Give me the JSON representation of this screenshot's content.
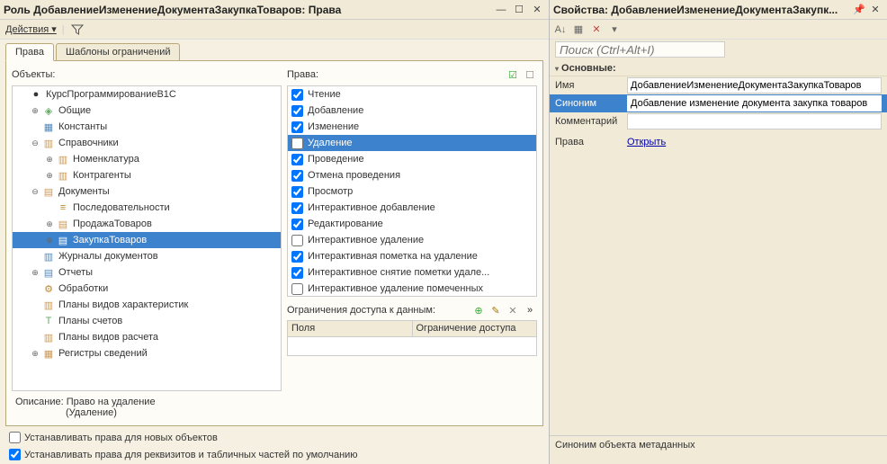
{
  "window": {
    "title": "Роль ДобавлениеИзменениеДокументаЗакупкаТоваров: Права",
    "actions_label": "Действия ▾"
  },
  "tabs": {
    "rights": "Права",
    "templates": "Шаблоны ограничений"
  },
  "headers": {
    "objects": "Объекты:",
    "rights": "Права:",
    "restrictions": "Ограничения доступа к данным:",
    "fields": "Поля",
    "restriction": "Ограничение доступа",
    "description": "Описание:"
  },
  "tree": {
    "root": "КурсПрограммированиеВ1С",
    "common": "Общие",
    "constants": "Константы",
    "catalogs": "Справочники",
    "catalog_nomenclature": "Номенклатура",
    "catalog_contractors": "Контрагенты",
    "documents": "Документы",
    "doc_sequences": "Последовательности",
    "doc_sales": "ПродажаТоваров",
    "doc_purchase": "ЗакупкаТоваров",
    "doc_journals": "Журналы документов",
    "reports": "Отчеты",
    "processing": "Обработки",
    "pcc": "Планы видов характеристик",
    "accounts": "Планы счетов",
    "pvr": "Планы видов расчета",
    "registers_info": "Регистры сведений"
  },
  "rights": {
    "r0": {
      "label": "Чтение",
      "checked": true
    },
    "r1": {
      "label": "Добавление",
      "checked": true
    },
    "r2": {
      "label": "Изменение",
      "checked": true
    },
    "r3": {
      "label": "Удаление",
      "checked": false
    },
    "r4": {
      "label": "Проведение",
      "checked": true
    },
    "r5": {
      "label": "Отмена проведения",
      "checked": true
    },
    "r6": {
      "label": "Просмотр",
      "checked": true
    },
    "r7": {
      "label": "Интерактивное добавление",
      "checked": true
    },
    "r8": {
      "label": "Редактирование",
      "checked": true
    },
    "r9": {
      "label": "Интерактивное удаление",
      "checked": false
    },
    "r10": {
      "label": "Интерактивная пометка на удаление",
      "checked": true
    },
    "r11": {
      "label": "Интерактивное снятие пометки удале...",
      "checked": true
    },
    "r12": {
      "label": "Интерактивное удаление помеченных",
      "checked": false
    }
  },
  "description": {
    "line1": "Право на удаление",
    "line2": "(Удаление)"
  },
  "settings": {
    "new_objects": "Устанавливать права для новых объектов",
    "defaults": "Устанавливать права для реквизитов и табличных частей по умолчанию"
  },
  "properties": {
    "title": "Свойства: ДобавлениеИзменениеДокументаЗакупк...",
    "search_placeholder": "Поиск (Ctrl+Alt+I)",
    "section_main": "Основные:",
    "name_label": "Имя",
    "name_value": "ДобавлениеИзменениеДокументаЗакупкаТоваров",
    "synonym_label": "Синоним",
    "synonym_value": "Добавление изменение документа закупка товаров",
    "comment_label": "Комментарий",
    "comment_value": "",
    "rights_label": "Права",
    "open_link": "Открыть"
  },
  "statusbar": "Синоним объекта метаданных"
}
